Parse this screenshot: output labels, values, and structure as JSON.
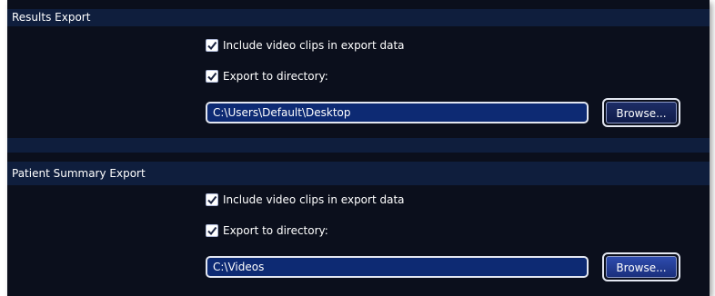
{
  "sections": [
    {
      "title": "Results Export",
      "include_video_label": "Include video clips in export data",
      "include_video_checked": true,
      "export_dir_label": "Export to directory:",
      "export_dir_checked": true,
      "directory_value": "C:\\Users\\Default\\Desktop",
      "browse_label": "Browse..."
    },
    {
      "title": "Patient Summary Export",
      "include_video_label": "Include video clips in export data",
      "include_video_checked": true,
      "export_dir_label": "Export to directory:",
      "export_dir_checked": true,
      "directory_value": "C:\\Videos",
      "browse_label": "Browse..."
    }
  ],
  "colors": {
    "panel_background": "#0b0f1c",
    "header_band": "#0f1e3d",
    "field_background": "#0d2a73",
    "button_active": "#2e4cae"
  },
  "icons": {
    "checkbox": "checkmark-icon"
  }
}
